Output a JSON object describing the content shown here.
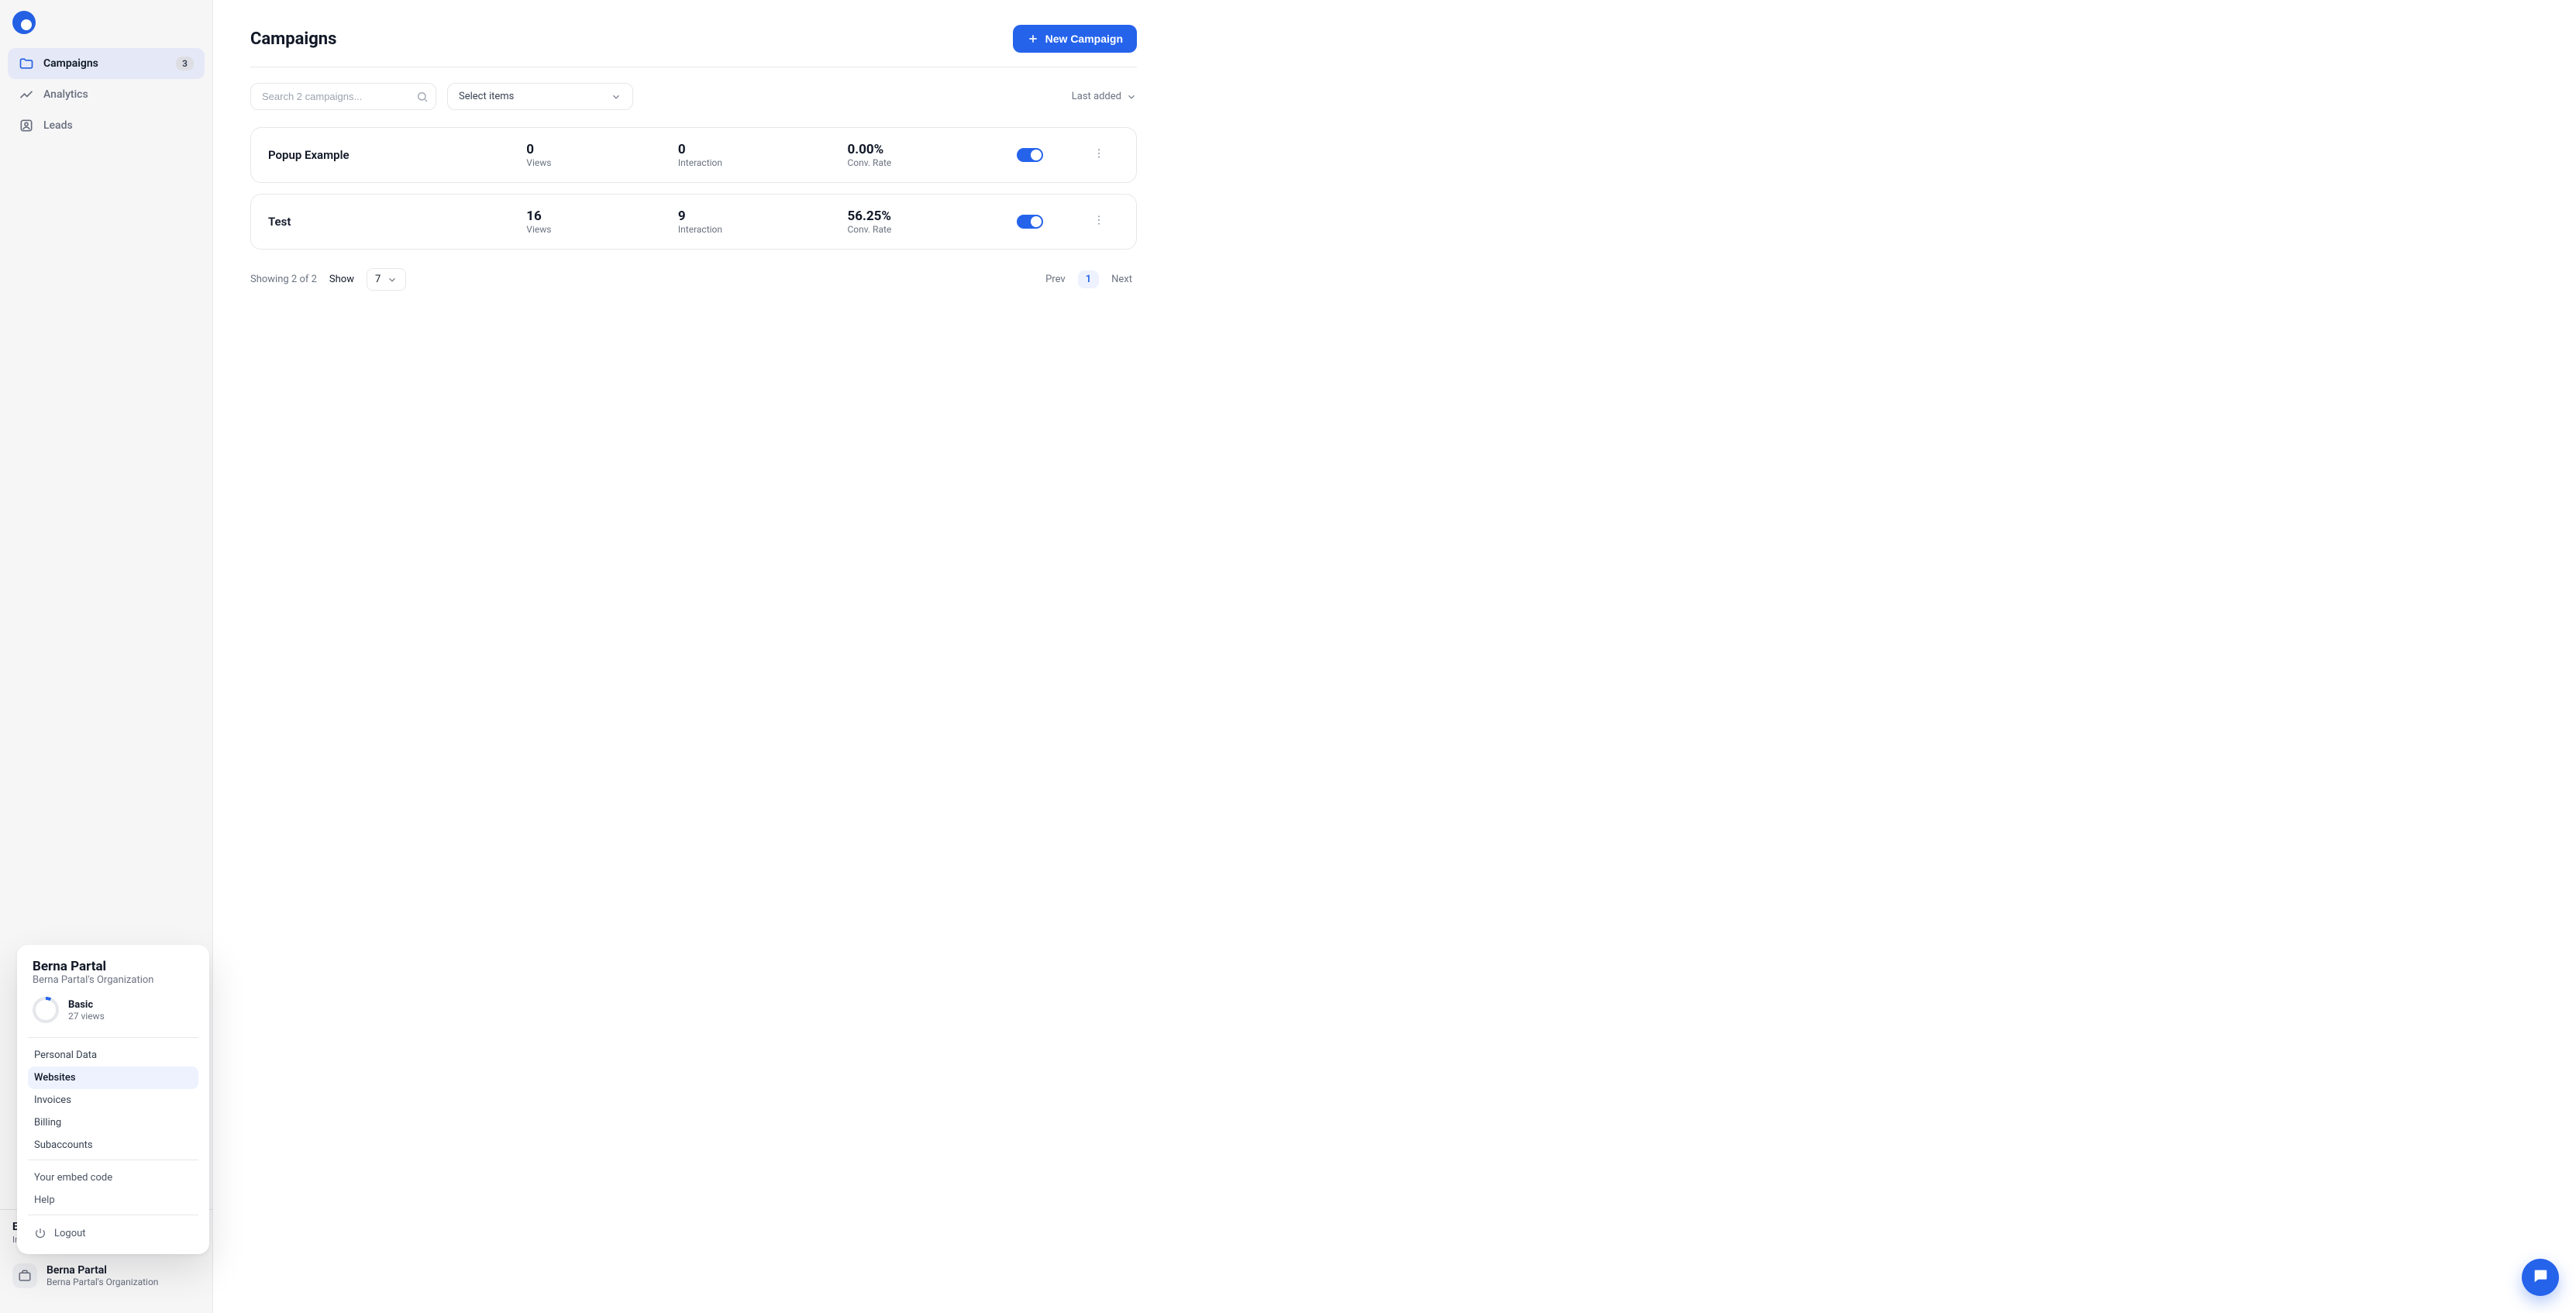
{
  "sidebar": {
    "nav": [
      {
        "key": "campaigns",
        "label": "Campaigns",
        "badge": "3",
        "active": true,
        "icon": "folder"
      },
      {
        "key": "analytics",
        "label": "Analytics",
        "icon": "chart"
      },
      {
        "key": "leads",
        "label": "Leads",
        "icon": "contact"
      }
    ],
    "embed_title": "Embed your code",
    "embed_subtitle": "Insert code on your website",
    "account": {
      "name": "Berna Partal",
      "org": "Berna Partal's Organization"
    }
  },
  "popover": {
    "name": "Berna Partal",
    "org": "Berna Partal's Organization",
    "plan_name": "Basic",
    "plan_views": "27 views",
    "items": [
      {
        "key": "personal",
        "label": "Personal Data"
      },
      {
        "key": "websites",
        "label": "Websites",
        "selected": true
      },
      {
        "key": "invoices",
        "label": "Invoices"
      },
      {
        "key": "billing",
        "label": "Billing"
      },
      {
        "key": "subaccounts",
        "label": "Subaccounts"
      }
    ],
    "embed_label": "Your embed code",
    "help_label": "Help",
    "logout_label": "Logout"
  },
  "header": {
    "title": "Campaigns",
    "new_button": "New Campaign"
  },
  "filters": {
    "search_placeholder": "Search 2 campaigns...",
    "select_label": "Select items",
    "sort_label": "Last added"
  },
  "labels": {
    "views": "Views",
    "interaction": "Interaction",
    "conv_rate": "Conv. Rate"
  },
  "campaigns": [
    {
      "name": "Popup Example",
      "views": "0",
      "interaction": "0",
      "conv_rate": "0.00%",
      "enabled": true
    },
    {
      "name": "Test",
      "views": "16",
      "interaction": "9",
      "conv_rate": "56.25%",
      "enabled": true
    }
  ],
  "pagination": {
    "showing": "Showing 2 of 2",
    "show_label": "Show",
    "page_size": "7",
    "prev": "Prev",
    "current": "1",
    "next": "Next"
  }
}
